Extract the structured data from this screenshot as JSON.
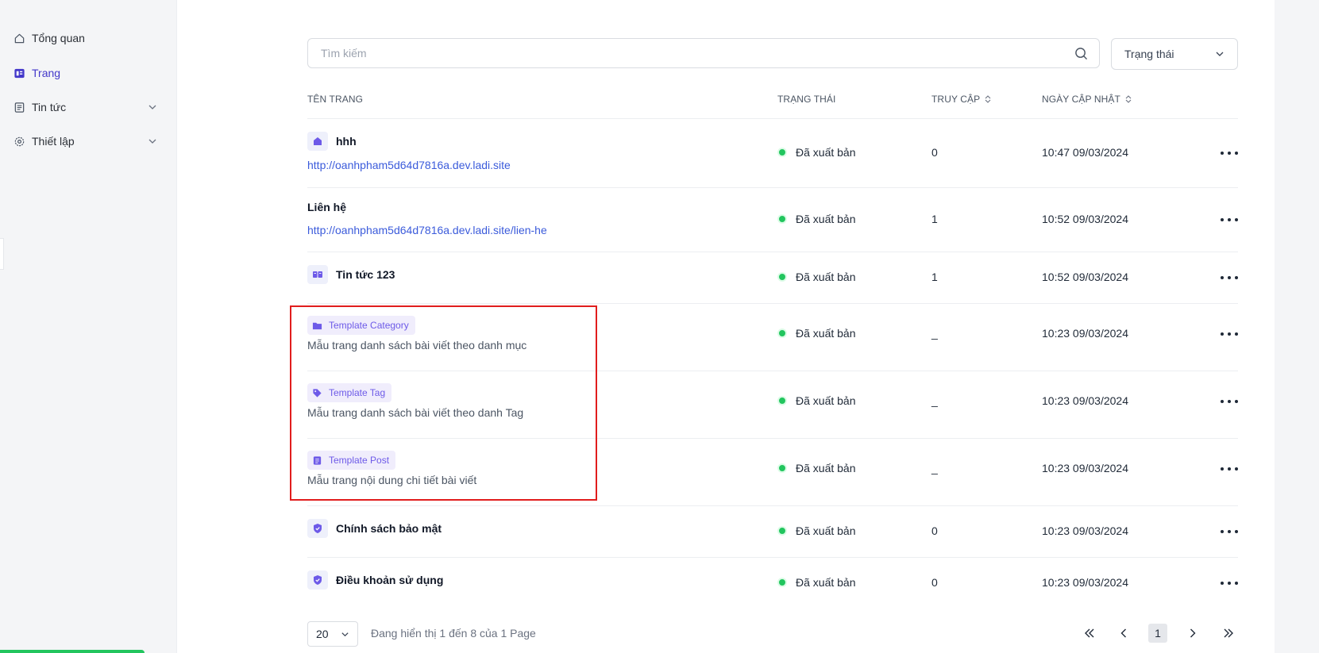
{
  "sidebar": {
    "items": [
      {
        "label": "Tổng quan",
        "icon": "home-icon"
      },
      {
        "label": "Trang",
        "icon": "page-icon"
      },
      {
        "label": "Tin tức",
        "icon": "news-icon"
      },
      {
        "label": "Thiết lập",
        "icon": "settings-icon"
      }
    ],
    "accent": "#4338ca"
  },
  "search": {
    "placeholder": "Tìm kiếm"
  },
  "filter": {
    "status_label": "Trạng thái"
  },
  "table": {
    "headers": {
      "name": "TÊN TRANG",
      "status": "TRẠNG THÁI",
      "visits": "TRUY CẬP",
      "updated": "NGÀY CẬP NHẬT"
    },
    "rows": [
      {
        "title": "hhh",
        "url": "http://oanhpham5d64d7816a.dev.ladi.site",
        "status": "Đã xuất bản",
        "visits": "0",
        "updated": "10:47 09/03/2024"
      },
      {
        "title": "Liên hệ",
        "url": "http://oanhpham5d64d7816a.dev.ladi.site/lien-he",
        "status": "Đã xuất bản",
        "visits": "1",
        "updated": "10:52 09/03/2024"
      },
      {
        "title": "Tin tức 123",
        "status": "Đã xuất bản",
        "visits": "1",
        "updated": "10:52 09/03/2024"
      },
      {
        "tag": "Template Category",
        "description": "Mẫu trang danh sách bài viết theo danh mục",
        "status": "Đã xuất bản",
        "visits": "_",
        "updated": "10:23 09/03/2024"
      },
      {
        "tag": "Template Tag",
        "description": "Mẫu trang danh sách bài viết theo danh Tag",
        "status": "Đã xuất bản",
        "visits": "_",
        "updated": "10:23 09/03/2024"
      },
      {
        "tag": "Template Post",
        "description": "Mẫu trang nội dung chi tiết bài viết",
        "status": "Đã xuất bản",
        "visits": "_",
        "updated": "10:23 09/03/2024"
      },
      {
        "title": "Chính sách bảo mật",
        "status": "Đã xuất bản",
        "visits": "0",
        "updated": "10:23 09/03/2024"
      },
      {
        "title": "Điều khoản sử dụng",
        "status": "Đã xuất bản",
        "visits": "0",
        "updated": "10:23 09/03/2024"
      }
    ],
    "status_color": "#22c55e"
  },
  "pagination": {
    "page_size": "20",
    "showing": "Đang hiển thị 1 đến 8 của 1 Page",
    "current_page": "1"
  }
}
